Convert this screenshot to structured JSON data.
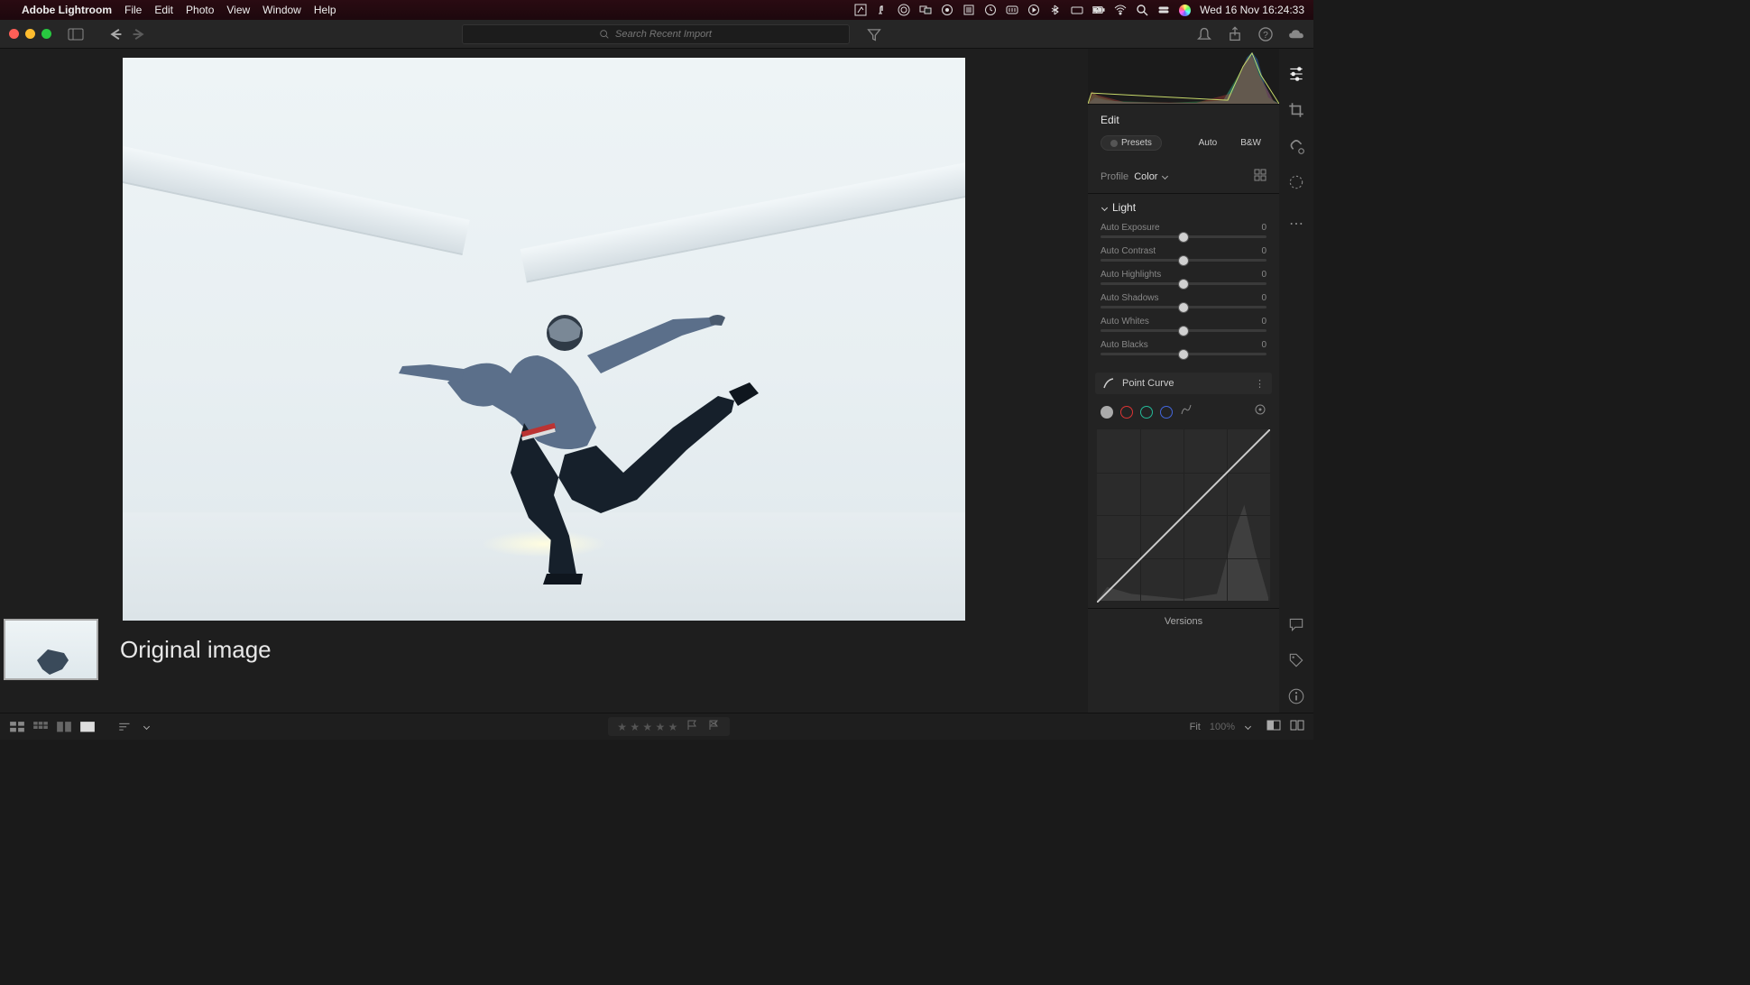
{
  "menubar": {
    "app_name": "Adobe Lightroom",
    "items": [
      "File",
      "Edit",
      "Photo",
      "View",
      "Window",
      "Help"
    ],
    "clock": "Wed 16 Nov  16:24:33"
  },
  "toolbar": {
    "search_placeholder": "Search Recent Import"
  },
  "caption": "Original image",
  "panel": {
    "title": "Edit",
    "presets_label": "Presets",
    "auto_label": "Auto",
    "bw_label": "B&W",
    "profile_label": "Profile",
    "profile_value": "Color",
    "light_label": "Light",
    "sliders": [
      {
        "label": "Auto Exposure",
        "value": "0"
      },
      {
        "label": "Auto Contrast",
        "value": "0"
      },
      {
        "label": "Auto Highlights",
        "value": "0"
      },
      {
        "label": "Auto Shadows",
        "value": "0"
      },
      {
        "label": "Auto Whites",
        "value": "0"
      },
      {
        "label": "Auto Blacks",
        "value": "0"
      }
    ],
    "point_curve_label": "Point Curve",
    "versions_label": "Versions"
  },
  "bottombar": {
    "fit_label": "Fit",
    "zoom_value": "100%"
  }
}
